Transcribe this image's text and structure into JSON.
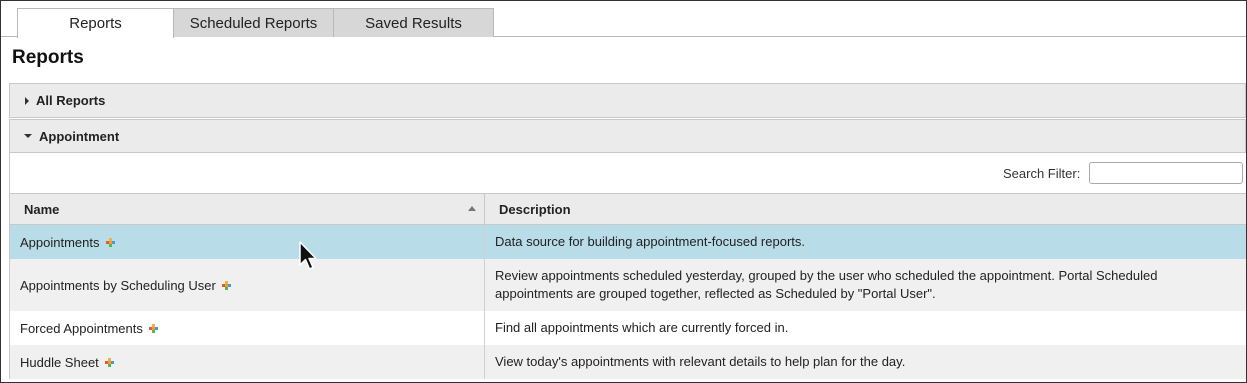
{
  "tabs": [
    {
      "label": "Reports",
      "active": true
    },
    {
      "label": "Scheduled Reports",
      "active": false
    },
    {
      "label": "Saved Results",
      "active": false
    }
  ],
  "page": {
    "title": "Reports"
  },
  "panels": {
    "all_reports": {
      "label": "All Reports",
      "expanded": false
    },
    "appointment": {
      "label": "Appointment",
      "expanded": true
    }
  },
  "filter": {
    "label": "Search Filter:",
    "value": "",
    "placeholder": ""
  },
  "table": {
    "columns": {
      "name": "Name",
      "description": "Description"
    },
    "sort": {
      "column": "Name",
      "direction": "ascending"
    },
    "rows": [
      {
        "name": "Appointments",
        "description": "Data source for building appointment-focused reports.",
        "selected": true,
        "icon": "plus-icon"
      },
      {
        "name": "Appointments by Scheduling User",
        "description": "Review appointments scheduled yesterday, grouped by the user who scheduled the appointment. Portal Scheduled appointments are grouped together, reflected as Scheduled by \"Portal User\".",
        "selected": false,
        "icon": "plus-icon"
      },
      {
        "name": "Forced Appointments",
        "description": "Find all appointments which are currently forced in.",
        "selected": false,
        "icon": "plus-icon"
      },
      {
        "name": "Huddle Sheet",
        "description": "View today's appointments with relevant details to help plan for the day.",
        "selected": false,
        "icon": "plus-icon"
      }
    ]
  },
  "colors": {
    "selected_row": "#b9dce9",
    "panel_bg": "#ebebeb",
    "tab_inactive": "#d7d7d7"
  }
}
